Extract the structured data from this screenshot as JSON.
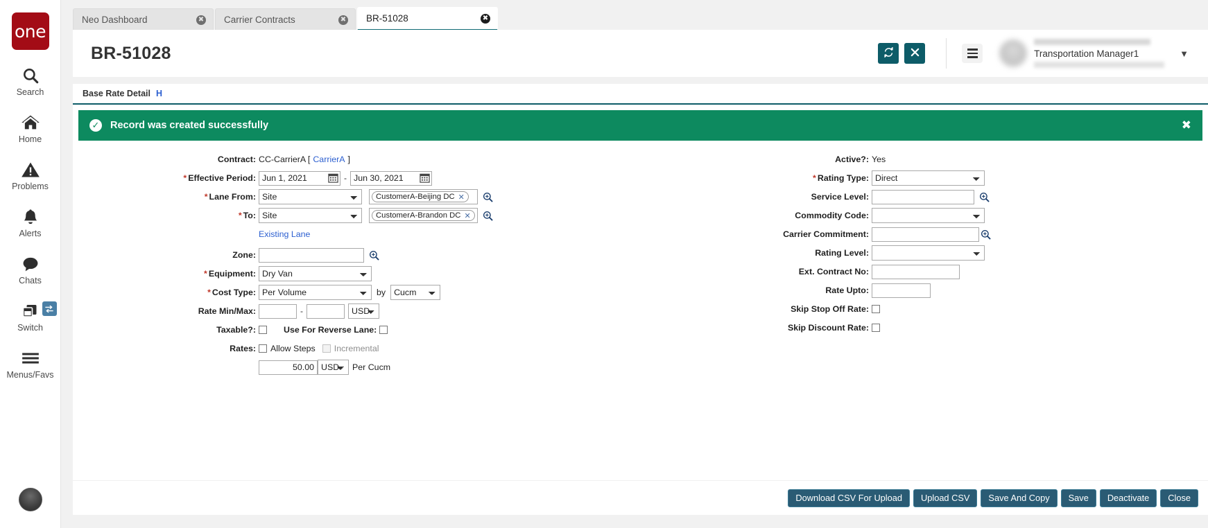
{
  "rail": {
    "logo_text": "one",
    "items": [
      {
        "label": "Search",
        "icon": "search-icon"
      },
      {
        "label": "Home",
        "icon": "home-icon"
      },
      {
        "label": "Problems",
        "icon": "warning-triangle-icon"
      },
      {
        "label": "Alerts",
        "icon": "bell-icon"
      },
      {
        "label": "Chats",
        "icon": "chat-bubble-icon"
      },
      {
        "label": "Switch",
        "icon": "windows-stack-icon"
      },
      {
        "label": "Menus/Favs",
        "icon": "hamburger-icon"
      }
    ]
  },
  "tabs": [
    {
      "title": "Neo Dashboard",
      "active": false
    },
    {
      "title": "Carrier Contracts",
      "active": false
    },
    {
      "title": "BR-51028",
      "active": true
    }
  ],
  "header": {
    "title": "BR-51028",
    "refresh_label": "refresh-icon",
    "close_label": "close-icon",
    "user_role": "Transportation Manager1"
  },
  "section": {
    "tab_label": "Base Rate Detail",
    "tab_hotkey": "H"
  },
  "banner": {
    "message": "Record was created successfully",
    "close": "✖"
  },
  "form": {
    "left": {
      "contract_label": "Contract:",
      "contract_value": "CC-CarrierA [",
      "contract_link": "CarrierA",
      "contract_value_end": "]",
      "effective_period_label": "Effective Period:",
      "effective_from": "Jun 1, 2021",
      "effective_to": "Jun 30, 2021",
      "lane_from_label": "Lane From:",
      "lane_from_type": "Site",
      "lane_from_token": "CustomerA-Beijing DC",
      "to_label": "To:",
      "to_type": "Site",
      "to_token": "CustomerA-Brandon DC",
      "existing_lane_link": "Existing Lane",
      "zone_label": "Zone:",
      "zone_value": "",
      "equipment_label": "Equipment:",
      "equipment_value": "Dry Van",
      "cost_type_label": "Cost Type:",
      "cost_type_value": "Per Volume",
      "cost_by_label": "by",
      "cost_by_value": "Cucm",
      "rate_minmax_label": "Rate Min/Max:",
      "rate_min": "",
      "rate_max": "",
      "rate_currency": "USD",
      "taxable_label": "Taxable?:",
      "taxable_checked": false,
      "reverse_lane_label": "Use For Reverse Lane:",
      "reverse_lane_checked": false,
      "rates_label": "Rates:",
      "allow_steps_label": "Allow Steps",
      "allow_steps_checked": false,
      "incremental_label": "Incremental",
      "incremental_checked": false,
      "rate_amount": "50.00",
      "rate_amount_currency": "USD",
      "rate_unit_label": "Per Cucm"
    },
    "right": {
      "active_label": "Active?:",
      "active_value": "Yes",
      "rating_type_label": "Rating Type:",
      "rating_type_value": "Direct",
      "service_level_label": "Service Level:",
      "service_level_value": "",
      "commodity_code_label": "Commodity Code:",
      "commodity_code_value": "",
      "carrier_commitment_label": "Carrier Commitment:",
      "carrier_commitment_value": "",
      "rating_level_label": "Rating Level:",
      "rating_level_value": "",
      "ext_contract_label": "Ext. Contract No:",
      "ext_contract_value": "",
      "rate_upto_label": "Rate Upto:",
      "rate_upto_value": "",
      "skip_stop_off_label": "Skip Stop Off Rate:",
      "skip_stop_off_checked": false,
      "skip_discount_label": "Skip Discount Rate:",
      "skip_discount_checked": false
    }
  },
  "footer": {
    "buttons": [
      "Download CSV For Upload",
      "Upload CSV",
      "Save And Copy",
      "Save",
      "Deactivate",
      "Close"
    ]
  },
  "colors": {
    "brand_red": "#a30c16",
    "teal": "#0d5c68",
    "success_green": "#0d8a5f",
    "footer_btn": "#2a5b74",
    "link_blue": "#2c5fd0"
  }
}
